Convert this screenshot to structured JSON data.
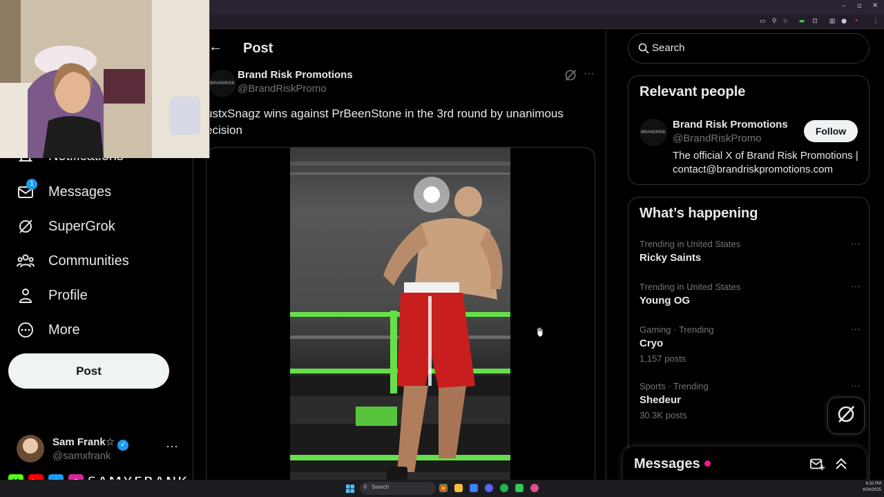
{
  "browser": {
    "window_controls": [
      "–",
      "▫",
      "✕"
    ]
  },
  "nav": {
    "items": [
      {
        "label": "Notifications",
        "icon": "bell-icon"
      },
      {
        "label": "Messages",
        "icon": "mail-icon",
        "badge": "1"
      },
      {
        "label": "SuperGrok",
        "icon": "grok-icon"
      },
      {
        "label": "Communities",
        "icon": "communities-icon"
      },
      {
        "label": "Profile",
        "icon": "person-icon"
      },
      {
        "label": "More",
        "icon": "more-circle-icon"
      }
    ],
    "post_button": "Post",
    "account": {
      "name": "Sam Frank☆",
      "handle": "@samxfrank"
    }
  },
  "main": {
    "title": "Post",
    "tweet": {
      "avatar_text": "BRANDRISK",
      "author_name": "Brand Risk Promotions",
      "author_handle": "@BrandRiskPromo",
      "text": "ustxSnagz wins against PrBeenStone in the 3rd round by unanimous ecision"
    }
  },
  "sidebar": {
    "search_placeholder": "Search",
    "relevant": {
      "title": "Relevant people",
      "avatar_text": "BRANDRISK",
      "name": "Brand Risk Promotions",
      "handle": "@BrandRiskPromo",
      "bio": "The official X of Brand Risk Promotions | contact@brandriskpromotions.com",
      "follow": "Follow"
    },
    "happening": {
      "title": "What’s happening",
      "trends": [
        {
          "meta": "Trending in United States",
          "name": "Ricky Saints",
          "posts": ""
        },
        {
          "meta": "Trending in United States",
          "name": "Young OG",
          "posts": ""
        },
        {
          "meta": "Gaming · Trending",
          "name": "Cryo",
          "posts": "1,157 posts"
        },
        {
          "meta": "Sports · Trending",
          "name": "Shedeur",
          "posts": "30.3K posts"
        }
      ]
    },
    "messages_drawer": "Messages"
  },
  "stream_overlay": {
    "handle": "SAMXFRANK"
  },
  "taskbar": {
    "search": "Search",
    "time": "6:32 PM",
    "date": "8/24/2025"
  },
  "colors": {
    "accent": "#1d9bf0",
    "notification_dot": "#f91880",
    "ring_rope": "#66e04a",
    "shorts_red": "#c81e1e"
  }
}
